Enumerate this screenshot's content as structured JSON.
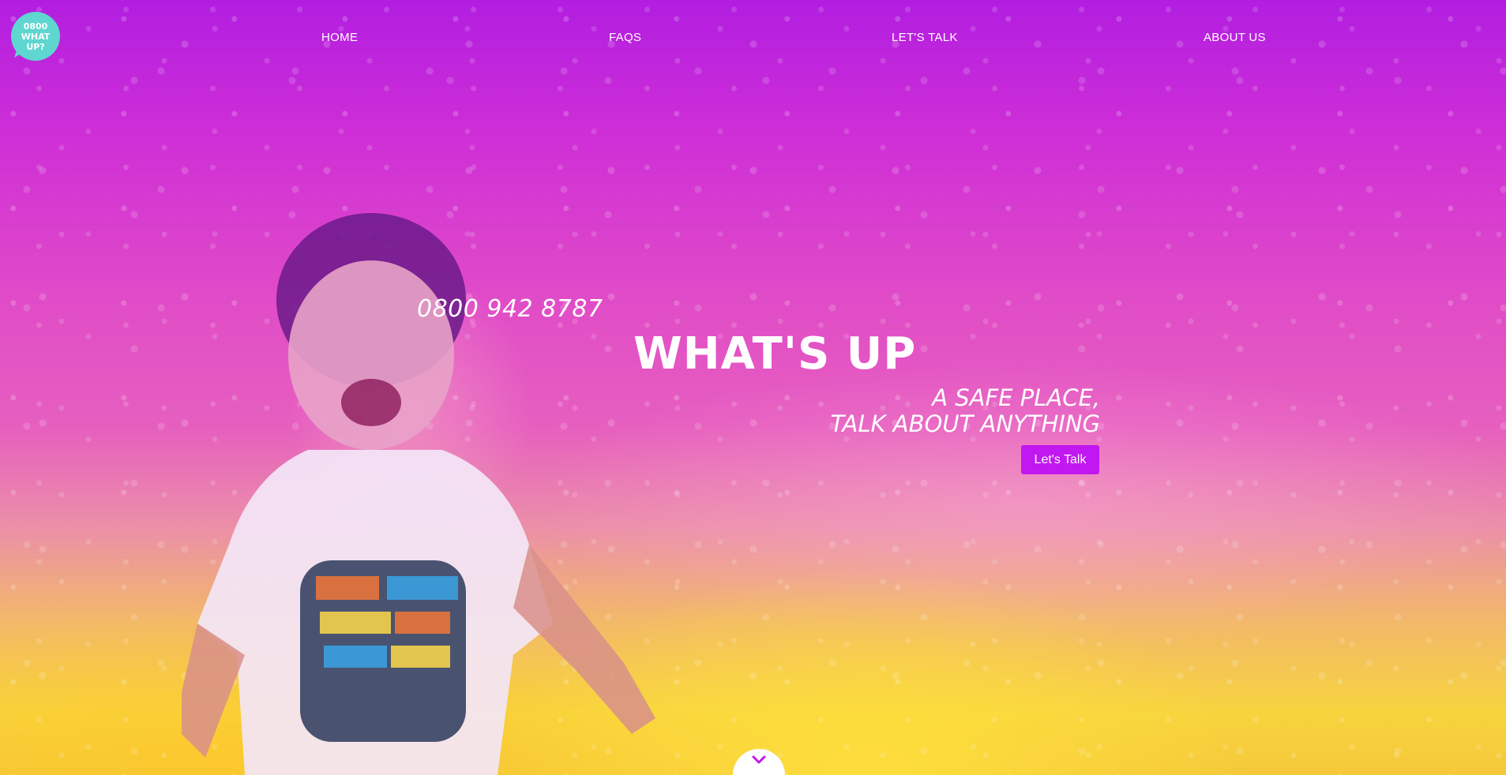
{
  "logo": {
    "icon": "speech-bubble-logo",
    "text_lines": [
      "0800",
      "WHAT",
      "UP?"
    ],
    "color": "#5fd6d0"
  },
  "nav": {
    "items": [
      {
        "label": "HOME"
      },
      {
        "label": "FAQS"
      },
      {
        "label": "LET'S TALK"
      },
      {
        "label": "ABOUT US"
      }
    ]
  },
  "hero": {
    "phone": "0800 942 8787",
    "title": "WHAT'S UP",
    "tagline_line1": "A SAFE PLACE,",
    "tagline_line2": "TALK ABOUT ANYTHING",
    "cta_label": "Let's Talk",
    "cta_color": "#c117f0",
    "scroll_icon": "chevron-down-icon"
  }
}
